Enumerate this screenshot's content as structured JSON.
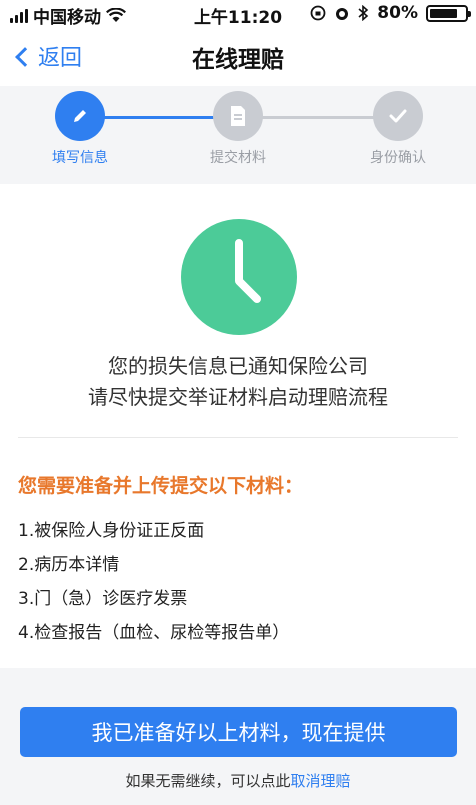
{
  "status_bar": {
    "carrier": "中国移动",
    "time": "上午11:20",
    "battery": "80%"
  },
  "nav": {
    "back_label": "返回",
    "title": "在线理赔"
  },
  "steps": [
    {
      "label": "填写信息",
      "state": "done",
      "icon": "pencil-icon"
    },
    {
      "label": "提交材料",
      "state": "todo",
      "icon": "document-icon"
    },
    {
      "label": "身份确认",
      "state": "todo",
      "icon": "check-icon"
    }
  ],
  "main": {
    "status_icon": "clock-icon",
    "message_line1": "您的损失信息已通知保险公司",
    "message_line2": "请尽快提交举证材料启动理赔流程",
    "requirements_title": "您需要准备并上传提交以下材料：",
    "requirements": [
      "1.被保险人身份证正反面",
      "2.病历本详情",
      "3.门（急）诊医疗发票",
      "4.检查报告（血检、尿检等报告单）"
    ]
  },
  "footer": {
    "confirm_label": "我已准备好以上材料，现在提供",
    "cancel_prefix": "如果无需继续，可以点此",
    "cancel_link": "取消理赔"
  },
  "colors": {
    "accent": "#2f7ff0",
    "success": "#4ccb98",
    "warning": "#e8782c",
    "inactive": "#c9ccd2"
  }
}
